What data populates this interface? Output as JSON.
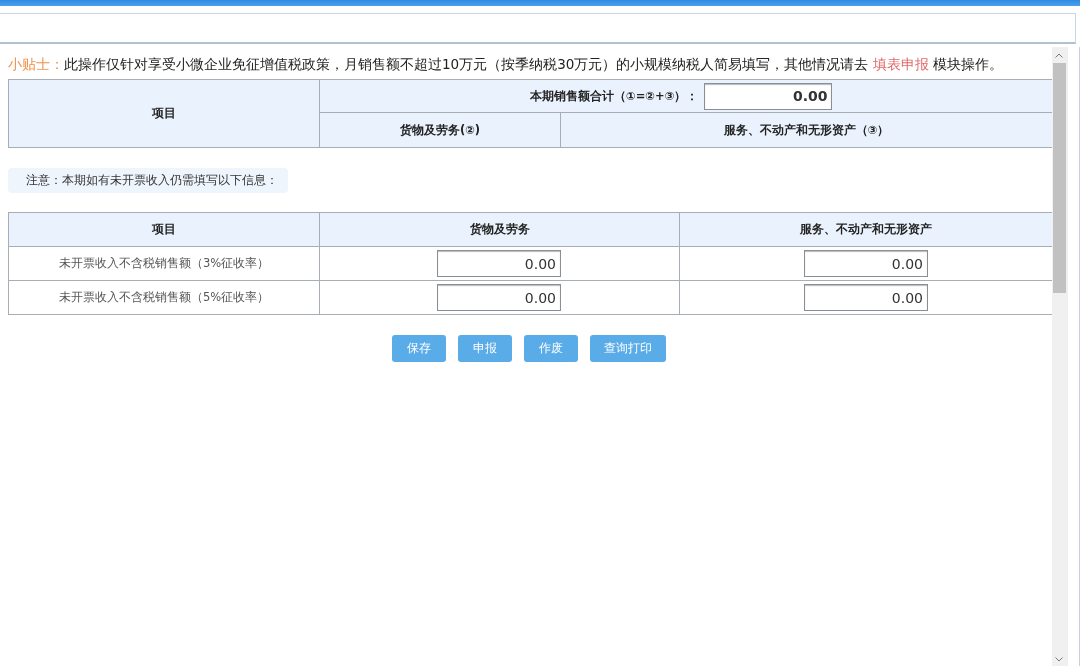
{
  "tip": {
    "label": "小贴士：",
    "text_before": "此操作仅针对享受小微企业免征增值税政策，月销售额不超过10万元（按季纳税30万元）的小规模纳税人简易填写，其他情况请去 ",
    "link": "填表申报",
    "text_after": " 模块操作。"
  },
  "summary_table": {
    "item_header": "项目",
    "total_label": "本期销售额合计（①=②+③）：",
    "total_value": "0.00",
    "columns": [
      "货物及劳务(②)",
      "服务、不动产和无形资产（③）"
    ]
  },
  "note": "注意：本期如有未开票收入仍需填写以下信息：",
  "income_table": {
    "columns": [
      "项目",
      "货物及劳务",
      "服务、不动产和无形资产"
    ],
    "rows": [
      {
        "label": "未开票收入不含税销售额（3%征收率）",
        "goods": "0.00",
        "services": "0.00"
      },
      {
        "label": "未开票收入不含税销售额（5%征收率）",
        "goods": "0.00",
        "services": "0.00"
      }
    ]
  },
  "buttons": [
    "保存",
    "申报",
    "作废",
    "查询打印"
  ]
}
